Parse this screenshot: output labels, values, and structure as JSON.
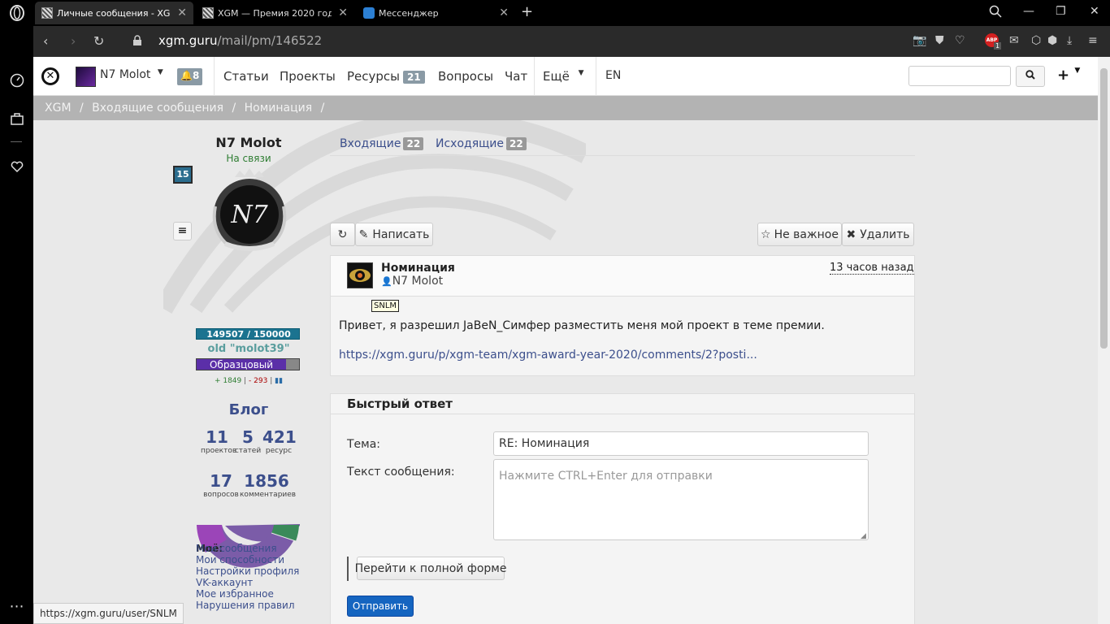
{
  "browser": {
    "tabs": [
      {
        "title": "Личные сообщения - XGM"
      },
      {
        "title": "XGM — Премия 2020 года - "
      },
      {
        "title": "Мессенджер"
      }
    ],
    "new_tab": "+",
    "url_host": "xgm.guru",
    "url_path": "/mail/pm/146522",
    "ext_badge": "ABP",
    "ext_count": "1",
    "status_url": "https://xgm.guru/user/SNLM"
  },
  "topnav": {
    "username": "N7 Molot",
    "notif_count": "8",
    "items": [
      "Статьи",
      "Проекты",
      "Ресурсы",
      "Вопросы",
      "Чат",
      "Ещё",
      "EN"
    ],
    "resources_count": "21"
  },
  "breadcrumb": [
    "XGM",
    "/",
    "Входящие сообщения",
    "/",
    "Номинация",
    "/"
  ],
  "profile": {
    "name": "N7 Molot",
    "status": "На связи",
    "level": "15",
    "xp": "149507 / 150000",
    "old_name": "old \"molot39\"",
    "rank": "Образцовый",
    "rep_plus": "+ 1849",
    "rep_minus": "- 293",
    "blog_title": "Блог",
    "stats": [
      {
        "value": "11",
        "label": "проектов"
      },
      {
        "value": "5",
        "label": "статей"
      },
      {
        "value": "421",
        "label": "ресурс"
      },
      {
        "value": "17",
        "label": "вопросов"
      },
      {
        "value": "1856",
        "label": "комментариев"
      }
    ],
    "menu_title": "Моё:",
    "menu": [
      "Мои сообщения",
      "Мои способности",
      "Настройки профиля",
      "VK-аккаунт",
      "Мое избранное",
      "Нарушения правил"
    ]
  },
  "mail": {
    "inbox_label": "Входящие",
    "inbox_count": "22",
    "outbox_label": "Исходящие",
    "outbox_count": "22",
    "write_label": "Написать",
    "not_important_label": "Не важное",
    "delete_label": "Удалить",
    "message": {
      "subject": "Номинация",
      "author": "N7 Molot",
      "time": "13 часов назад",
      "tooltip": "SNLM",
      "body": "Привет, я разрешил JaBeN_Симфер разместить меня мой проект в теме премии.",
      "link": "https://xgm.guru/p/xgm-team/xgm-award-year-2020/comments/2?posti..."
    },
    "reply": {
      "title": "Быстрый ответ",
      "subject_label": "Тема:",
      "subject_value": "RE: Номинация",
      "text_label": "Текст сообщения:",
      "text_placeholder": "Нажмите CTRL+Enter для отправки",
      "full_form_label": "Перейти к полной форме",
      "send_label": "Отправить"
    }
  },
  "colors": {
    "accent": "#3c4f8c",
    "send_button": "#1565c0",
    "rank_bar": "#5b2fa8"
  }
}
